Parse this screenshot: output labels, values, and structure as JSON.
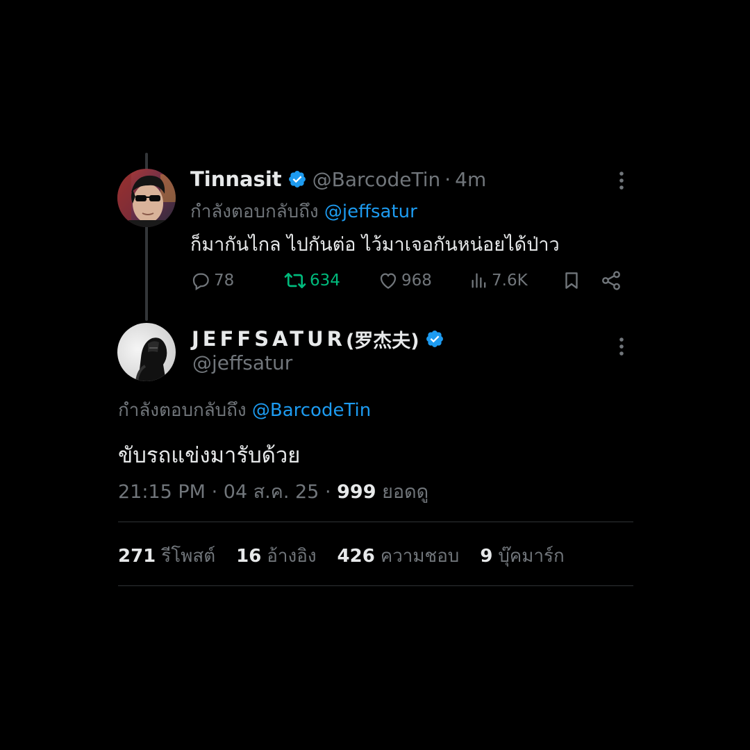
{
  "colors": {
    "background": "#000000",
    "text_primary": "#e7e9ea",
    "text_secondary": "#71767b",
    "accent": "#1d9bf0",
    "retweet_green": "#00ba7c",
    "divider": "#2f3336"
  },
  "reply_tweet": {
    "display_name": "Tinnasit",
    "verified_icon": "verified-badge-icon",
    "handle": "@BarcodeTin",
    "separator": "·",
    "time": "4m",
    "replying_prefix": "กำลังตอบกลับถึง",
    "replying_mention": "@jeffsatur",
    "text": "ก็มากันไกล ไปกันต่อ ไว้มาเจอกันหน่อยได้ป่าว",
    "actions": {
      "replies": "78",
      "retweets": "634",
      "likes": "968",
      "views": "7.6K"
    }
  },
  "main_tweet": {
    "display_name": "JEFFSATUR",
    "display_name_cn": "(罗杰夫)",
    "verified_icon": "verified-badge-icon",
    "handle": "@jeffsatur",
    "replying_prefix": "กำลังตอบกลับถึง",
    "replying_mention": "@BarcodeTin",
    "text": "ขับรถแข่งมารับด้วย",
    "timestamp": "21:15 PM",
    "separator": "·",
    "date": "04 ส.ค. 25",
    "views_count": "999",
    "views_label": "ยอดดู",
    "stats": {
      "reposts_count": "271",
      "reposts_label": "รีโพสต์",
      "quotes_count": "16",
      "quotes_label": "อ้างอิง",
      "likes_count": "426",
      "likes_label": "ความชอบ",
      "bookmarks_count": "9",
      "bookmarks_label": "บุ๊คมาร์ก"
    }
  }
}
